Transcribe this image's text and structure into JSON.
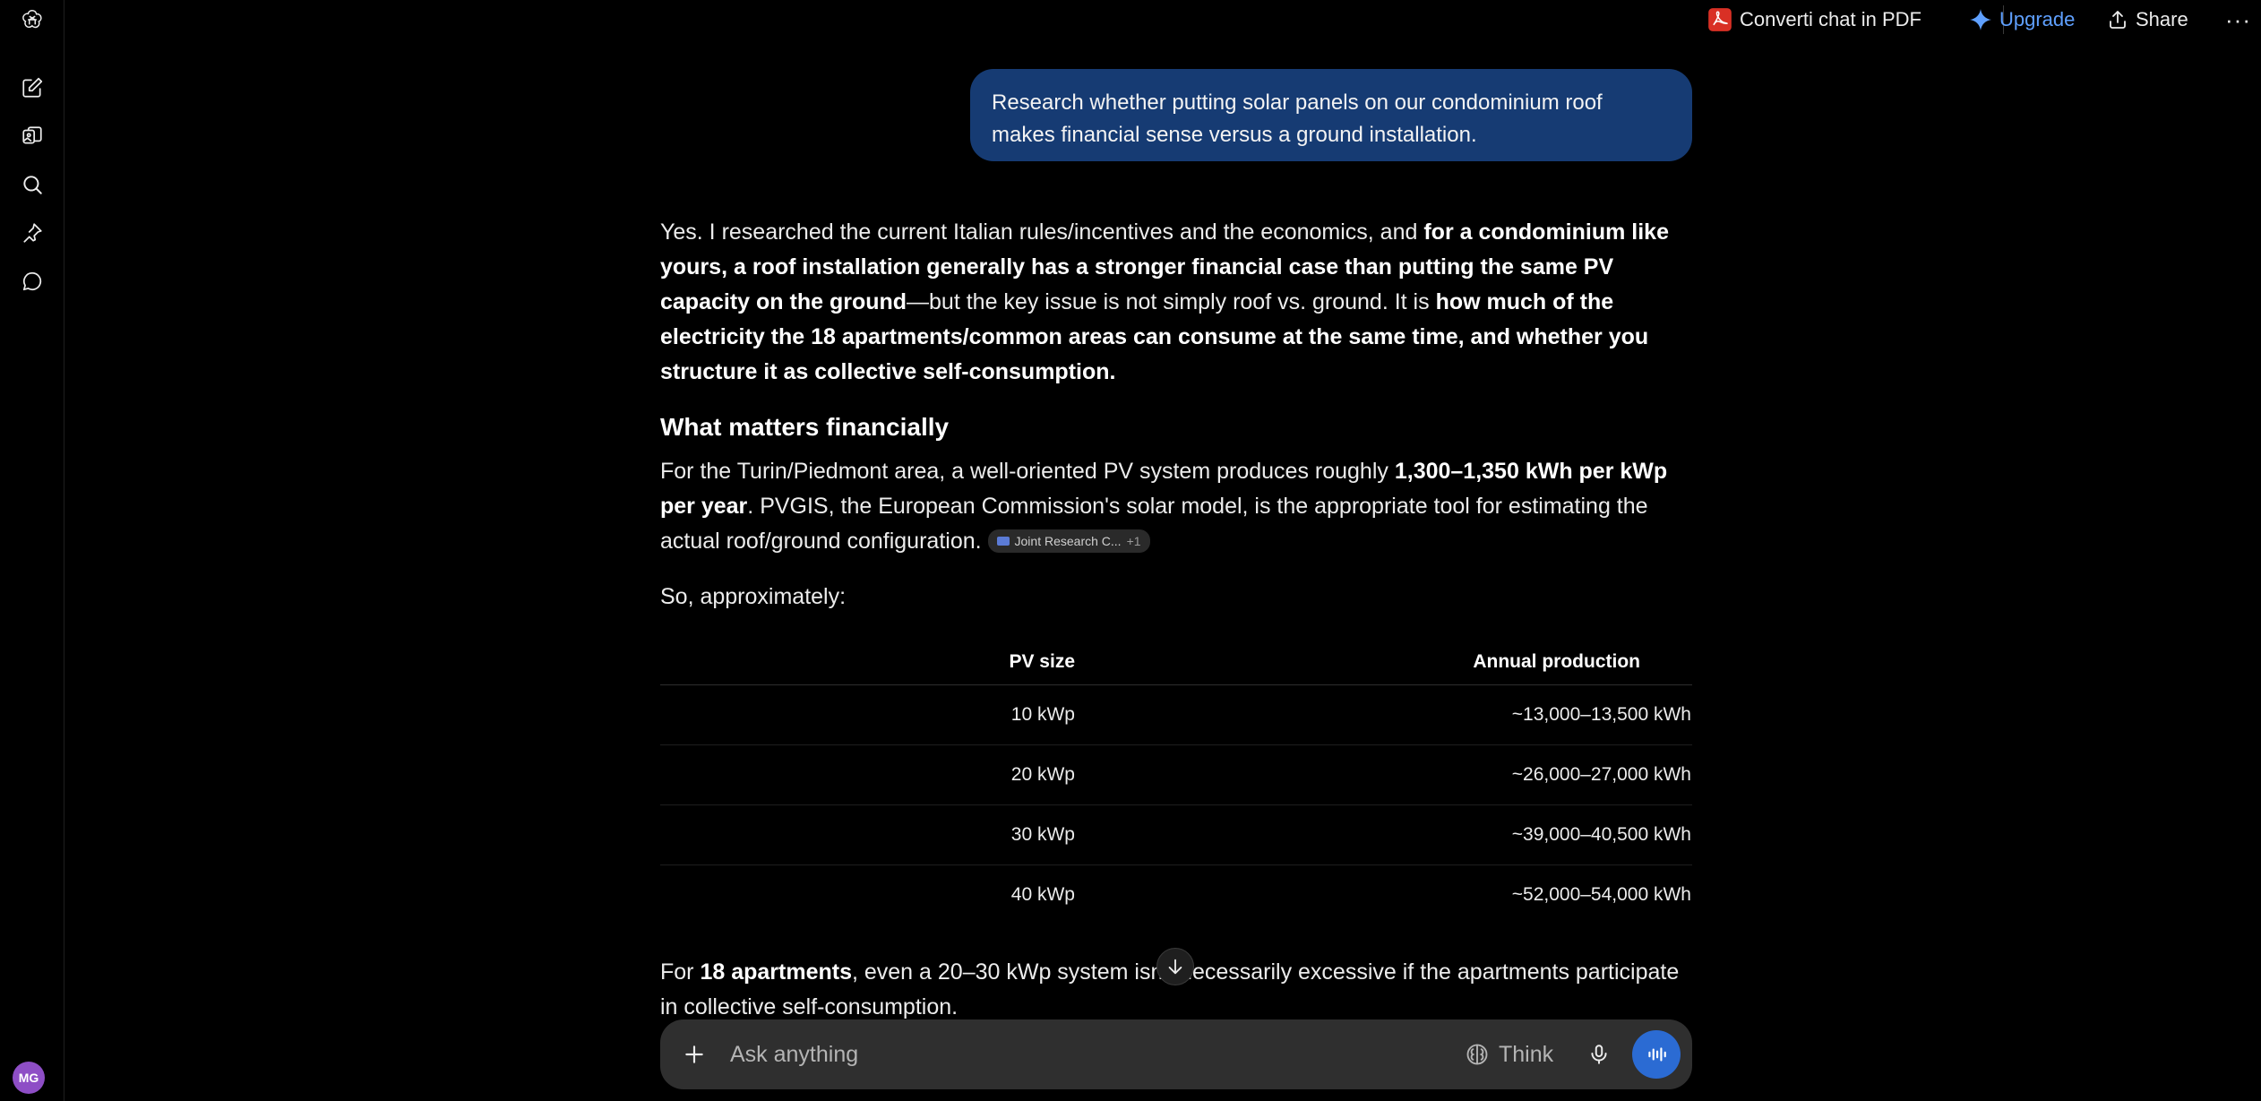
{
  "colors": {
    "background": "#000000",
    "user_bubble": "#163b73",
    "accent_blue": "#2b6bd3",
    "upgrade_blue": "#5fa0ff",
    "pdf_red": "#d93025",
    "avatar_bg": "#8e4ec6"
  },
  "sidebar": {
    "items": [
      {
        "icon": "openai-logo-icon"
      },
      {
        "icon": "new-chat-icon"
      },
      {
        "icon": "library-icon"
      },
      {
        "icon": "search-icon"
      },
      {
        "icon": "pin-icon"
      },
      {
        "icon": "chat-bubble-icon"
      }
    ],
    "avatar_initials": "MG"
  },
  "topbar": {
    "pdf_label": "Converti chat in PDF",
    "upgrade_label": "Upgrade",
    "share_label": "Share",
    "more_label": "···"
  },
  "conversation": {
    "user_message": "Research whether putting solar panels on our condominium roof makes financial sense versus a ground installation.",
    "p1": {
      "t1": "Yes. I researched the current Italian rules/incentives and the economics, and ",
      "b1": "for a condominium like yours, a roof installation generally has a stronger financial case than putting the same PV capacity on the ground",
      "t2": "—but the key issue is not simply roof vs. ground. It is ",
      "b2": "how much of the electricity the 18 apartments/common areas can consume at the same time, and whether you structure it as collective self-consumption."
    },
    "heading": "What matters financially",
    "p2": {
      "t1": "For the Turin/Piedmont area, a well-oriented PV system produces roughly ",
      "b1": "1,300–1,350 kWh per kWp per year",
      "t2": ". PVGIS, the European Commission's solar model, is the appropriate tool for estimating the actual roof/ground configuration. "
    },
    "citation": {
      "label": "Joint Research C...",
      "more": "+1"
    },
    "p3": "So, approximately:",
    "table": {
      "headers": [
        "PV size",
        "Annual production"
      ],
      "rows": [
        [
          "10 kWp",
          "~13,000–13,500 kWh"
        ],
        [
          "20 kWp",
          "~26,000–27,000 kWh"
        ],
        [
          "30 kWp",
          "~39,000–40,500 kWh"
        ],
        [
          "40 kWp",
          "~52,000–54,000 kWh"
        ]
      ]
    },
    "p4": {
      "t1": "For ",
      "b1": "18 apartments",
      "t2": ", even a 20–30 kWp system isn't necessarily excessive if the apartments participate in collective self-consumption."
    }
  },
  "composer": {
    "placeholder": "Ask anything",
    "think_label": "Think"
  }
}
